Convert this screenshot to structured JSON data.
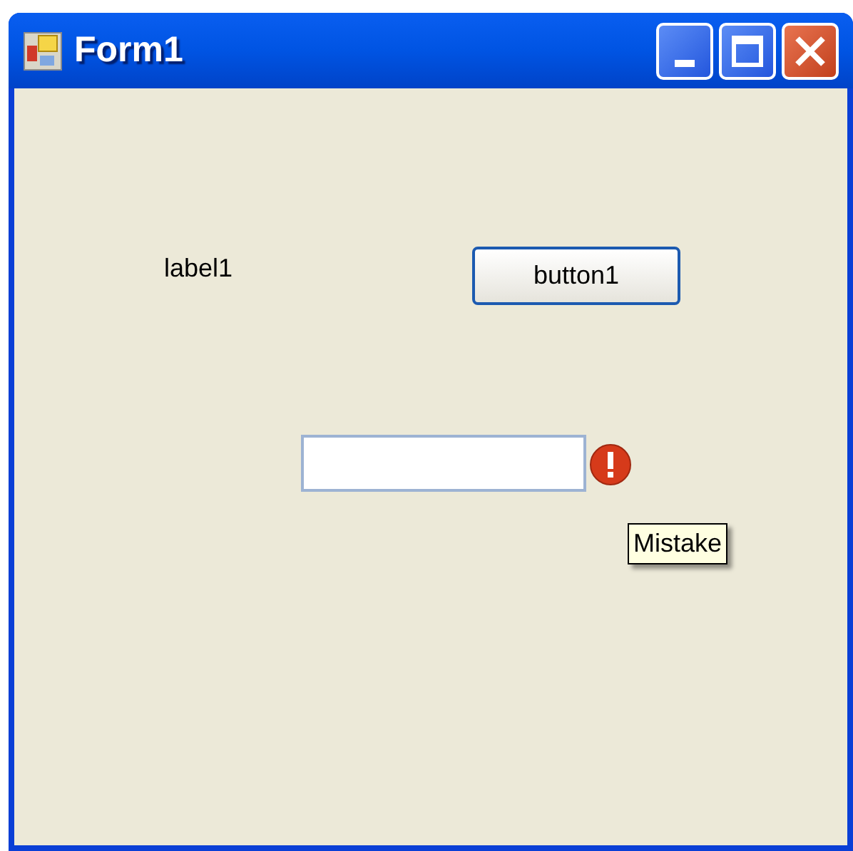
{
  "window": {
    "title": "Form1"
  },
  "label": "label1",
  "button": "button1",
  "error_tooltip": "Mistake"
}
